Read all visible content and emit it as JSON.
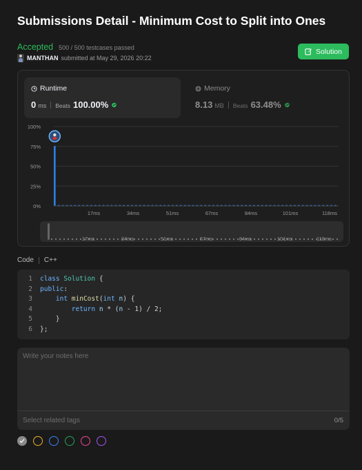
{
  "header": {
    "title": "Submissions Detail - Minimum Cost to Split into Ones",
    "status": "Accepted",
    "testcases": "500 / 500 testcases passed",
    "username": "MANTHAN",
    "submitted_text": "submitted at May 29, 2026 20:22",
    "solution_button": "Solution"
  },
  "colors": {
    "accent_green": "#2cbb5d",
    "bar_blue": "#2a7fe0"
  },
  "runtime": {
    "label": "Runtime",
    "value": "0",
    "unit": "ms",
    "beats_label": "Beats",
    "beats": "100.00%",
    "icon": "clock-icon"
  },
  "memory": {
    "label": "Memory",
    "value": "8.13",
    "unit": "MB",
    "beats_label": "Beats",
    "beats": "63.48%",
    "icon": "memory-chip-icon"
  },
  "chart_data": {
    "type": "bar",
    "y_ticks": [
      "100%",
      "75%",
      "50%",
      "25%",
      "0%"
    ],
    "ylim": [
      0,
      100
    ],
    "x_ticks": [
      "17ms",
      "34ms",
      "51ms",
      "67ms",
      "84ms",
      "101ms",
      "118ms"
    ],
    "user_marker_at": "0ms",
    "series": [
      {
        "values": [
          75.5,
          1.2,
          1.2,
          1.2,
          1.2,
          1.2,
          1.2,
          1.2,
          1.2,
          1.2,
          1.2,
          1.2,
          1.2,
          1.2,
          1.2,
          1.2,
          1.2,
          1.2,
          1.2,
          1.2,
          1.2,
          1.2,
          1.2,
          1.2,
          1.2,
          1.2,
          1.2,
          1.2,
          1.2,
          1.2,
          1.2,
          1.2,
          1.2,
          1.2,
          1.2,
          1.2,
          1.2,
          1.2,
          1.2,
          1.2,
          1.2,
          1.2,
          1.2,
          1.2,
          1.2,
          1.2,
          1.2,
          1.2,
          1.2,
          1.2,
          1.2,
          1.2,
          1.2,
          1.2,
          1.2,
          1.2,
          1.2,
          1.2,
          1.2,
          1.2,
          1.2,
          1.2,
          1.2,
          1.2,
          1.2,
          1.2,
          1.2,
          1.2,
          1.2,
          1.2
        ]
      }
    ]
  },
  "code": {
    "label": "Code",
    "language": "C++",
    "lines": [
      {
        "num": "1",
        "text": "class Solution {"
      },
      {
        "num": "2",
        "text": "public:"
      },
      {
        "num": "3",
        "text": "    int minCost(int n) {"
      },
      {
        "num": "4",
        "text": "        return n * (n - 1) / 2;"
      },
      {
        "num": "5",
        "text": "    }"
      },
      {
        "num": "6",
        "text": "};"
      }
    ]
  },
  "notes": {
    "placeholder": "Write your notes here",
    "tags_placeholder": "Select related tags",
    "tags_count": "0/5"
  },
  "note_colors": [
    "#8a8a8a",
    "#f0b429",
    "#3b82f6",
    "#22a55a",
    "#ec4899",
    "#a855f7"
  ]
}
